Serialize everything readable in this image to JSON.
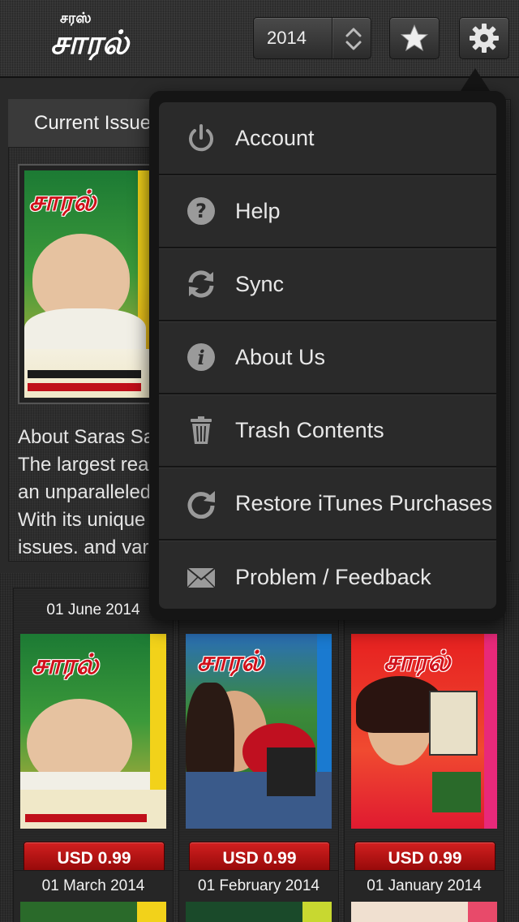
{
  "app": {
    "logo_small": "சரஸ்",
    "logo_big": "சாரல்"
  },
  "toolbar": {
    "year": "2014",
    "star_icon": "star-icon",
    "gear_icon": "gear-icon"
  },
  "current_issue": {
    "tab_label": "Current Issue",
    "cover_title": "சாரல்",
    "about_lines": [
      "About Saras Sali",
      "The largest read",
      "an unparalleled r",
      "With its unique m",
      "issues, and varie"
    ]
  },
  "menu": {
    "items": [
      {
        "label": "Account",
        "icon": "power-icon"
      },
      {
        "label": "Help",
        "icon": "help-icon"
      },
      {
        "label": "Sync",
        "icon": "sync-icon"
      },
      {
        "label": "About Us",
        "icon": "info-icon"
      },
      {
        "label": "Trash Contents",
        "icon": "trash-icon"
      },
      {
        "label": "Restore iTunes Purchases",
        "icon": "restore-icon"
      },
      {
        "label": "Problem / Feedback",
        "icon": "mail-icon"
      }
    ]
  },
  "issues": [
    {
      "date": "01 June 2014",
      "price": "USD 0.99",
      "cover_title": "சாரல்"
    },
    {
      "date": "",
      "price": "USD 0.99",
      "cover_title": "சாரல்"
    },
    {
      "date": "",
      "price": "USD 0.99",
      "cover_title": "சாரல்"
    }
  ],
  "issues_row2": [
    {
      "date": "01 March 2014"
    },
    {
      "date": "01 February 2014"
    },
    {
      "date": "01 January 2014"
    }
  ],
  "colors": {
    "accent_red": "#c01010",
    "menu_bg": "#2a2a2a"
  }
}
